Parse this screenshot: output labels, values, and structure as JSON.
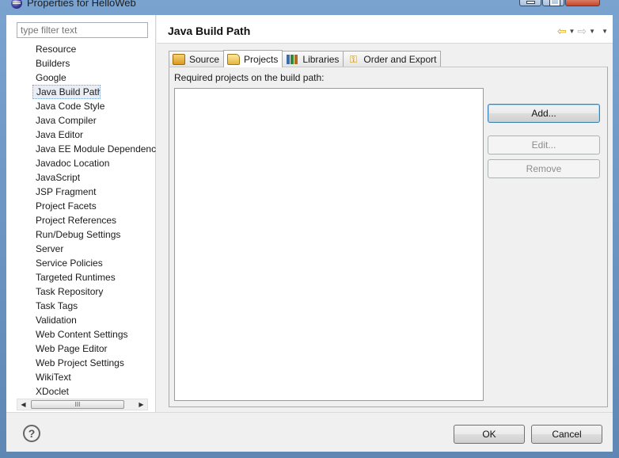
{
  "window": {
    "title": "Properties for HelloWeb"
  },
  "filter": {
    "placeholder": "type filter text"
  },
  "tree": {
    "items": [
      "Resource",
      "Builders",
      "Google",
      "Java Build Path",
      "Java Code Style",
      "Java Compiler",
      "Java Editor",
      "Java EE Module Dependencies",
      "Javadoc Location",
      "JavaScript",
      "JSP Fragment",
      "Project Facets",
      "Project References",
      "Run/Debug Settings",
      "Server",
      "Service Policies",
      "Targeted Runtimes",
      "Task Repository",
      "Task Tags",
      "Validation",
      "Web Content Settings",
      "Web Page Editor",
      "Web Project Settings",
      "WikiText",
      "XDoclet"
    ],
    "selected": "Java Build Path"
  },
  "header": {
    "title": "Java Build Path"
  },
  "tabs": [
    {
      "label": "Source",
      "icon": "source-folder-icon"
    },
    {
      "label": "Projects",
      "icon": "project-folder-icon",
      "active": true
    },
    {
      "label": "Libraries",
      "icon": "libraries-icon"
    },
    {
      "label": "Order and Export",
      "icon": "order-export-icon"
    }
  ],
  "projects_tab": {
    "label": "Required projects on the build path:",
    "add_label": "Add...",
    "edit_label": "Edit...",
    "remove_label": "Remove"
  },
  "footer": {
    "help_glyph": "?",
    "ok_label": "OK",
    "cancel_label": "Cancel"
  },
  "scrollbar": {
    "thumb_glyph": "III"
  }
}
